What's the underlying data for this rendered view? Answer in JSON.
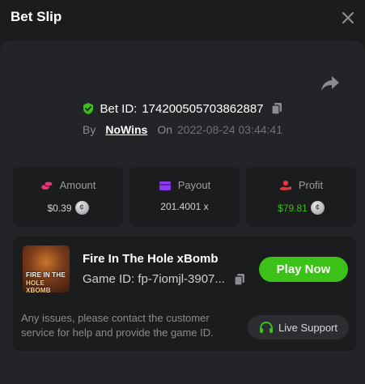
{
  "header": {
    "title": "Bet Slip"
  },
  "bet": {
    "id_label": "Bet ID:",
    "id_value": "174200505703862887",
    "by_label": "By",
    "user": "NoWins",
    "on_label": "On",
    "date": "2022-08-24 03:44:41"
  },
  "stats": [
    {
      "label": "Amount",
      "value": "$0.39",
      "color": "#d0d1d4",
      "icon": "coins-icon"
    },
    {
      "label": "Payout",
      "value": "201.4001 x",
      "color": "#d0d1d4",
      "icon": "wallet-icon"
    },
    {
      "label": "Profit",
      "value": "$79.81",
      "color": "#3bc117",
      "icon": "hand-coins-icon"
    }
  ],
  "game": {
    "name": "Fire In The Hole xBomb",
    "id_text": "Game ID: fp-7iomjl-3907...",
    "thumb_line1": "FIRE IN THE",
    "thumb_line2": "HOLE XBOMB",
    "play_label": "Play Now"
  },
  "support": {
    "note": "Any issues, please contact the customer service for help and provide the game ID.",
    "button_label": "Live Support"
  },
  "colors": {
    "accent_green": "#3bc117",
    "pink": "#e6357a",
    "purple": "#8b3cf0",
    "red": "#e5343b"
  }
}
